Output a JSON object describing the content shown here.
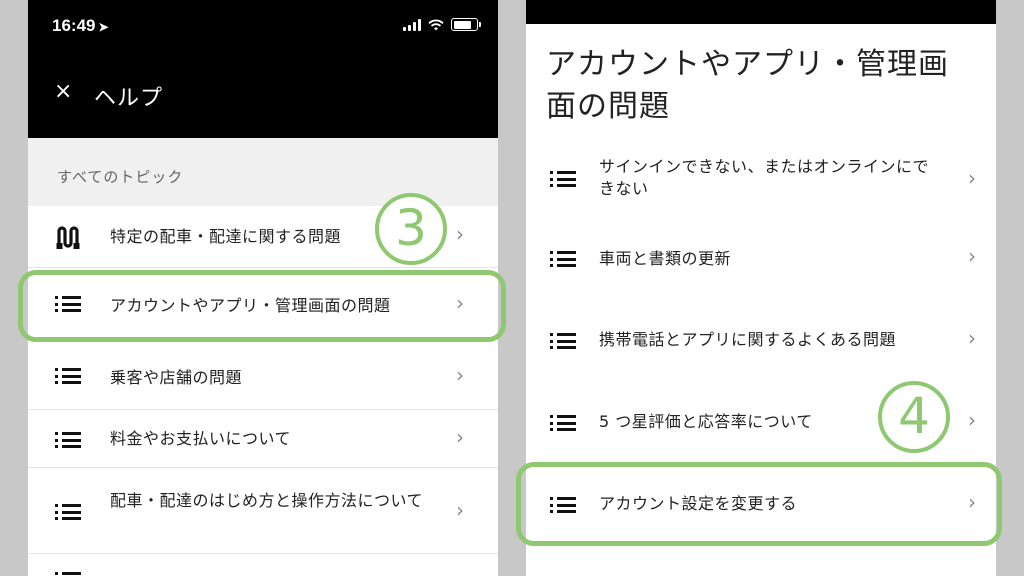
{
  "left": {
    "status": {
      "time": "16:49",
      "location_icon": "location-arrow-icon"
    },
    "header": {
      "close": "×",
      "title": "ヘルプ"
    },
    "section_label": "すべてのトピック",
    "items": [
      {
        "label": "特定の配車・配達に関する問題",
        "icon": "route-icon"
      },
      {
        "label": "アカウントやアプリ・管理画面の問題",
        "icon": "list-icon"
      },
      {
        "label": "乗客や店舗の問題",
        "icon": "list-icon"
      },
      {
        "label": "料金やお支払いについて",
        "icon": "list-icon"
      },
      {
        "label": "配車・配達のはじめ方と操作方法について",
        "icon": "list-icon"
      }
    ],
    "step": "3"
  },
  "right": {
    "title": "アカウントやアプリ・管理画面の問題",
    "items": [
      {
        "label": "サインインできない、またはオンラインにできない",
        "icon": "list-icon"
      },
      {
        "label": "車両と書類の更新",
        "icon": "list-icon"
      },
      {
        "label": "携帯電話とアプリに関するよくある問題",
        "icon": "list-icon"
      },
      {
        "label": "5 つ星評価と応答率について",
        "icon": "list-icon"
      },
      {
        "label": "アカウント設定を変更する",
        "icon": "list-icon"
      }
    ],
    "step": "4"
  },
  "chevron": "›",
  "colors": {
    "highlight": "#8fc871",
    "header_bg": "#000000",
    "section_bg": "#f0f0f0"
  }
}
